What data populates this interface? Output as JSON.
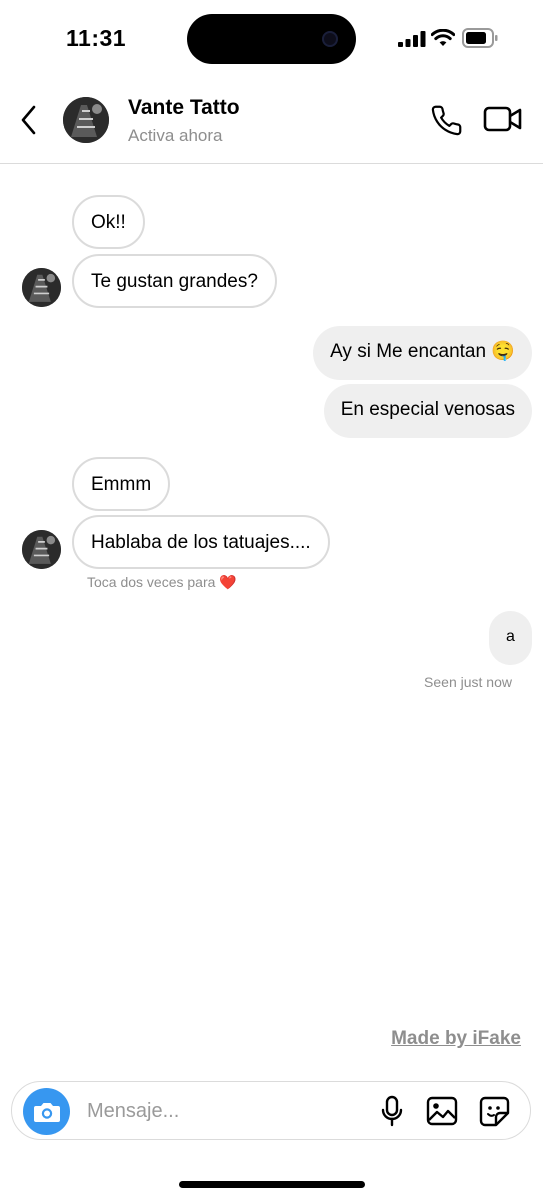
{
  "status_bar": {
    "time": "11:31"
  },
  "header": {
    "contact_name": "Vante Tatto",
    "contact_status": "Activa ahora",
    "icons": [
      "back-icon",
      "phone-icon",
      "video-camera-icon"
    ]
  },
  "messages": [
    {
      "direction": "incoming",
      "text": "Ok!!"
    },
    {
      "direction": "incoming",
      "text": "Te gustan grandes?"
    },
    {
      "direction": "outgoing",
      "text": "Ay si Me encantan 🤤"
    },
    {
      "direction": "outgoing",
      "text": "En especial venosas"
    },
    {
      "direction": "incoming",
      "text": "Emmm"
    },
    {
      "direction": "incoming",
      "text": "Hablaba de los tatuajes...."
    },
    {
      "direction": "outgoing",
      "text": "a"
    }
  ],
  "like_hint": {
    "text": "Toca dos veces para",
    "emoji": "❤️"
  },
  "seen_status": "Seen just now",
  "watermark": "Made by iFake",
  "composer": {
    "placeholder": "Mensaje...",
    "icons": [
      "camera-icon",
      "microphone-icon",
      "gallery-icon",
      "sticker-icon"
    ]
  },
  "colors": {
    "accent": "#3797f0",
    "outgoing_bubble": "#efefef",
    "incoming_border": "#dbdbdb",
    "secondary_text": "#8e8e8e"
  }
}
